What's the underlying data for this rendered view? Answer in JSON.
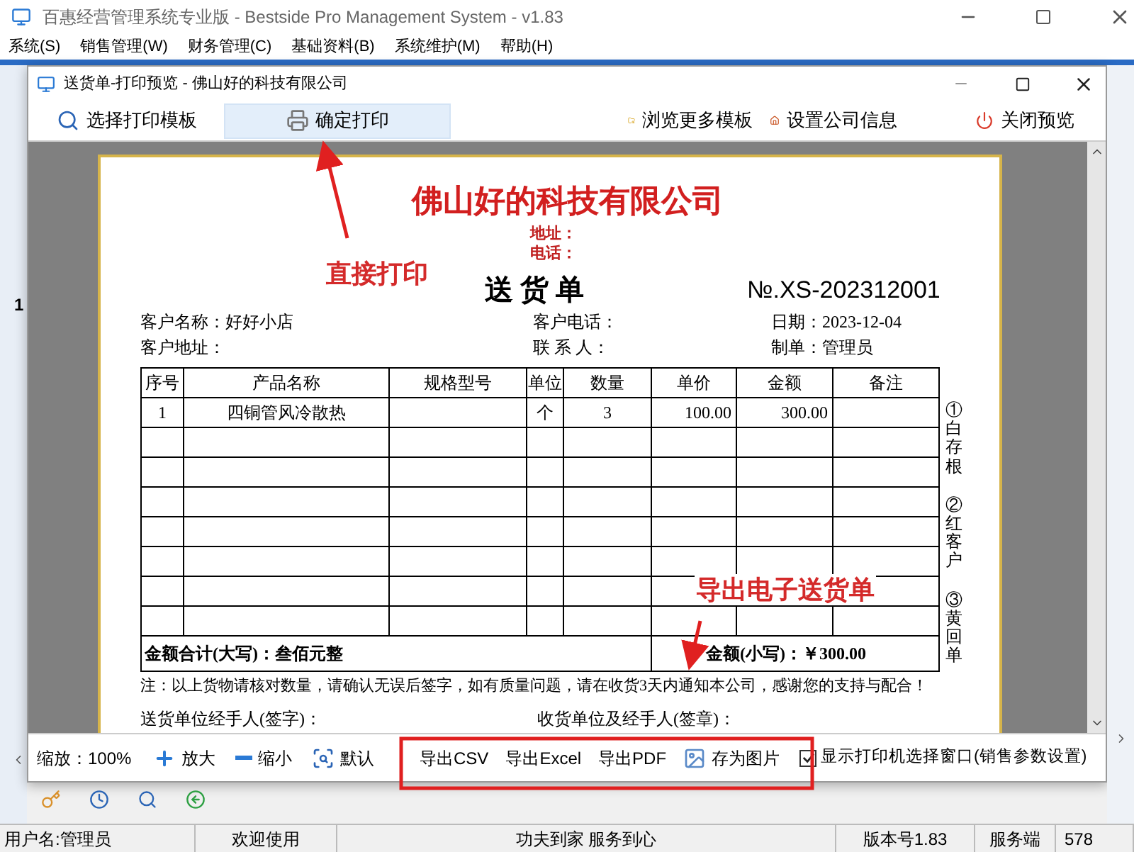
{
  "app": {
    "title": "百惠经营管理系统专业版 - Bestside Pro Management System - v1.83",
    "menu": [
      "系统(S)",
      "销售管理(W)",
      "财务管理(C)",
      "基础资料(B)",
      "系统维护(M)",
      "帮助(H)"
    ],
    "row_number": "1"
  },
  "dialog": {
    "title": "送货单-打印预览 - 佛山好的科技有限公司",
    "toolbar": [
      {
        "label": "选择打印模板",
        "highlighted": false
      },
      {
        "label": "确定打印",
        "highlighted": true
      },
      {
        "label": "浏览更多模板",
        "highlighted": false
      },
      {
        "label": "设置公司信息",
        "highlighted": false
      },
      {
        "label": "关闭预览",
        "highlighted": false
      }
    ]
  },
  "document": {
    "company": "佛山好的科技有限公司",
    "address_label": "地址：",
    "phone_label": "电话：",
    "title": "送 货 单",
    "number": "№.XS-202312001",
    "info": [
      [
        {
          "label": "客户名称：",
          "value": "好好小店"
        },
        {
          "label": "客户电话："
        },
        {
          "label": "日期：",
          "value": "2023-12-04"
        }
      ],
      [
        {
          "label": "客户地址："
        },
        {
          "label": "联 系 人："
        },
        {
          "label": "制单：",
          "value": "管理员"
        }
      ]
    ],
    "columns": [
      "序号",
      "产品名称",
      "规格型号",
      "单位",
      "数量",
      "单价",
      "金额",
      "备注"
    ],
    "rows": [
      {
        "no": "1",
        "name": "四铜管风冷散热",
        "unit": "个",
        "qty": "3",
        "price": "100.00",
        "amount": "300.00"
      }
    ],
    "total_words": "金额合计(大写)：叁佰元整",
    "total_amount": "金额(小写)：￥300.00",
    "copies": [
      "①白存根",
      "②红客户",
      "③黄回单"
    ],
    "note": "注：以上货物请核对数量，请确认无误后签字，如有质量问题，请在收货3天内通知本公司，感谢您的支持与配合！",
    "signatures": [
      "送货单位经手人(签字)：",
      "收货单位及经手人(签章)："
    ]
  },
  "bottom_toolbar": {
    "zoom": "缩放：100%",
    "buttons": [
      "放大",
      "缩小",
      "默认"
    ],
    "export_buttons": [
      "导出CSV",
      "导出Excel",
      "导出PDF",
      "存为图片"
    ],
    "checkbox": {
      "label": "显示打印机选择窗口(销售参数设置)",
      "checked": true
    }
  },
  "annotations": [
    "直接打印",
    "导出电子送货单"
  ],
  "status_bar": [
    "用户名:管理员",
    "欢迎使用",
    "功夫到家 服务到心",
    "版本号1.83",
    "服务端",
    "578"
  ]
}
